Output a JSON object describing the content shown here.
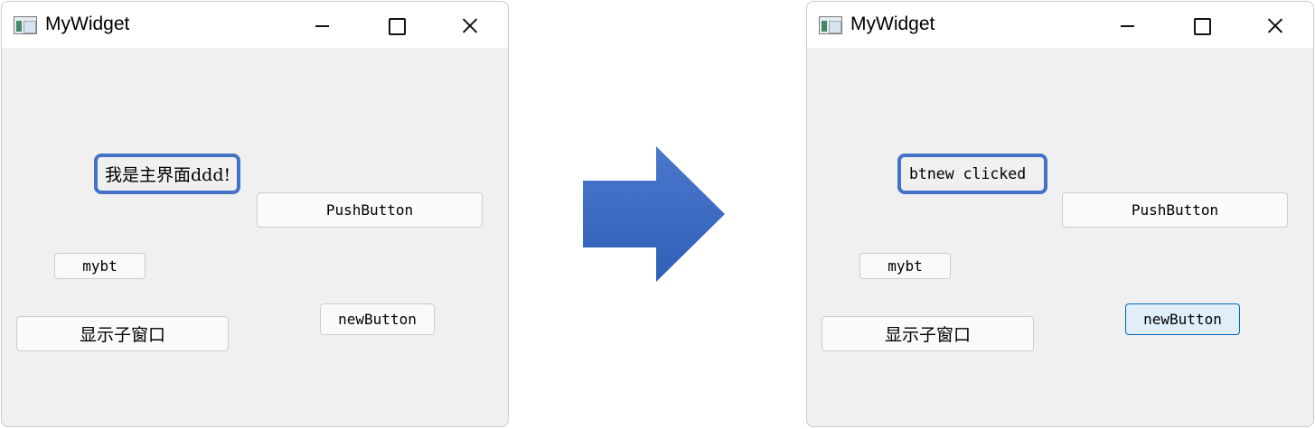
{
  "before_window": {
    "title": "MyWidget",
    "label_text": "我是主界面ddd!",
    "buttons": {
      "push": "PushButton",
      "mybt": "mybt",
      "new_button": "newButton",
      "show_child": "显示子窗口"
    }
  },
  "after_window": {
    "title": "MyWidget",
    "label_text": "btnew clicked",
    "buttons": {
      "push": "PushButton",
      "mybt": "mybt",
      "new_button": "newButton",
      "show_child": "显示子窗口"
    }
  },
  "colors": {
    "highlight_border": "#4472c4",
    "arrow_top": "#4a78cc",
    "arrow_bottom": "#2f5fb8",
    "hover_button_bg": "#e0eef9",
    "hover_button_border": "#0067c0"
  },
  "icons": {
    "window_controls": [
      "minimize-icon",
      "maximize-icon",
      "close-icon"
    ],
    "transition": "right-arrow-icon"
  }
}
